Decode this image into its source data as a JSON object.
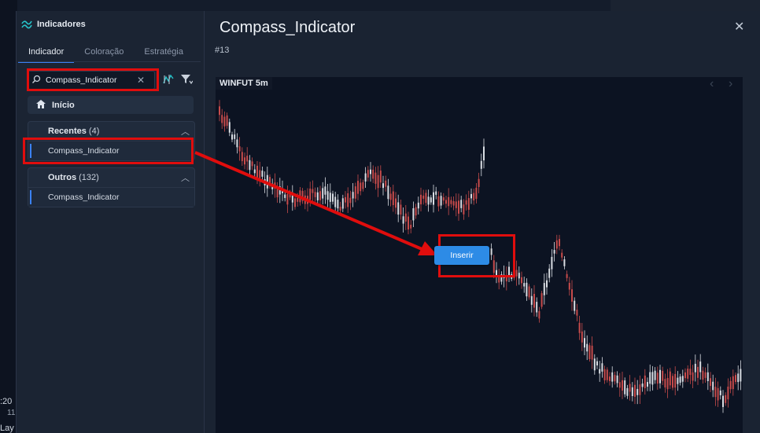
{
  "background": {
    "time_left": ":20",
    "time_left2": "11",
    "layer_label": "Lay"
  },
  "dialog": {
    "panel_title": "Indicadores",
    "tabs": [
      {
        "label": "Indicador",
        "active": true
      },
      {
        "label": "Coloração",
        "active": false
      },
      {
        "label": "Estratégia",
        "active": false
      }
    ],
    "search": {
      "value": "Compass_Indicator",
      "placeholder": ""
    },
    "home_label": "Início",
    "groups": [
      {
        "name": "Recentes",
        "count": "(4)",
        "items": [
          "Compass_Indicator"
        ]
      },
      {
        "name": "Outros",
        "count": "(132)",
        "items": [
          "Compass_Indicator"
        ]
      }
    ],
    "detail": {
      "title": "Compass_Indicator",
      "id": "#13",
      "preview_label": "WINFUT 5m",
      "insert_label": "Inserir"
    }
  },
  "colors": {
    "accent": "#2d8be6",
    "annotation": "#e00d0d",
    "candle_up": "#d9dde3",
    "candle_down": "#c84b4b"
  },
  "icons": [
    "logo-icon",
    "search-icon",
    "clear-icon",
    "indicator-style-icon",
    "filter-icon",
    "home-icon",
    "chevron-up-icon",
    "close-icon",
    "chevron-left-icon",
    "chevron-right-icon"
  ]
}
